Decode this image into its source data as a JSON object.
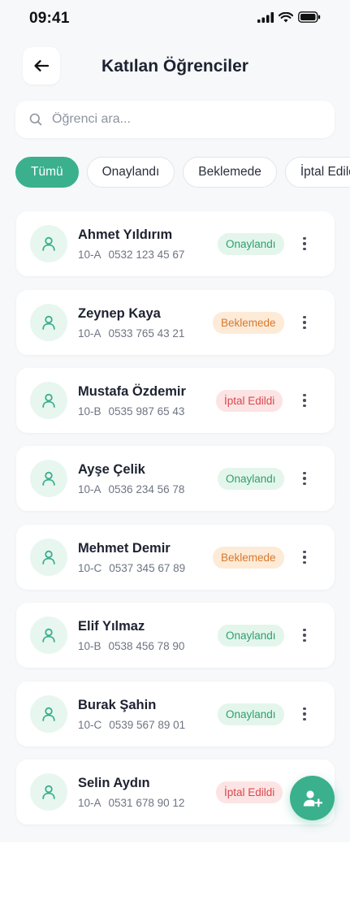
{
  "status_bar": {
    "time": "09:41"
  },
  "header": {
    "title": "Katılan Öğrenciler"
  },
  "search": {
    "placeholder": "Öğrenci ara..."
  },
  "filters": [
    {
      "label": "Tümü",
      "active": true
    },
    {
      "label": "Onaylandı",
      "active": false
    },
    {
      "label": "Beklemede",
      "active": false
    },
    {
      "label": "İptal Edildi",
      "active": false
    }
  ],
  "students": [
    {
      "name": "Ahmet Yıldırım",
      "class": "10-A",
      "phone": "0532 123 45 67",
      "status": "Onaylandı",
      "status_type": "approved"
    },
    {
      "name": "Zeynep Kaya",
      "class": "10-A",
      "phone": "0533 765 43 21",
      "status": "Beklemede",
      "status_type": "pending"
    },
    {
      "name": "Mustafa Özdemir",
      "class": "10-B",
      "phone": "0535 987 65 43",
      "status": "İptal Edildi",
      "status_type": "cancelled"
    },
    {
      "name": "Ayşe Çelik",
      "class": "10-A",
      "phone": "0536 234 56 78",
      "status": "Onaylandı",
      "status_type": "approved"
    },
    {
      "name": "Mehmet Demir",
      "class": "10-C",
      "phone": "0537 345 67 89",
      "status": "Beklemede",
      "status_type": "pending"
    },
    {
      "name": "Elif Yılmaz",
      "class": "10-B",
      "phone": "0538 456 78 90",
      "status": "Onaylandı",
      "status_type": "approved"
    },
    {
      "name": "Burak Şahin",
      "class": "10-C",
      "phone": "0539 567 89 01",
      "status": "Onaylandı",
      "status_type": "approved"
    },
    {
      "name": "Selin Aydın",
      "class": "10-A",
      "phone": "0531 678 90 12",
      "status": "İptal Edildi",
      "status_type": "cancelled"
    }
  ],
  "icons": {
    "back": "arrow-left-icon",
    "search": "search-icon",
    "avatar": "user-icon",
    "more": "more-vertical-icon",
    "fab": "add-user-icon"
  },
  "colors": {
    "accent": "#3ab08d",
    "approved_bg": "#e4f6ec",
    "approved_text": "#2f9f6c",
    "pending_bg": "#fdebd8",
    "pending_text": "#d9782b",
    "cancelled_bg": "#fde4e4",
    "cancelled_text": "#d9474d"
  }
}
